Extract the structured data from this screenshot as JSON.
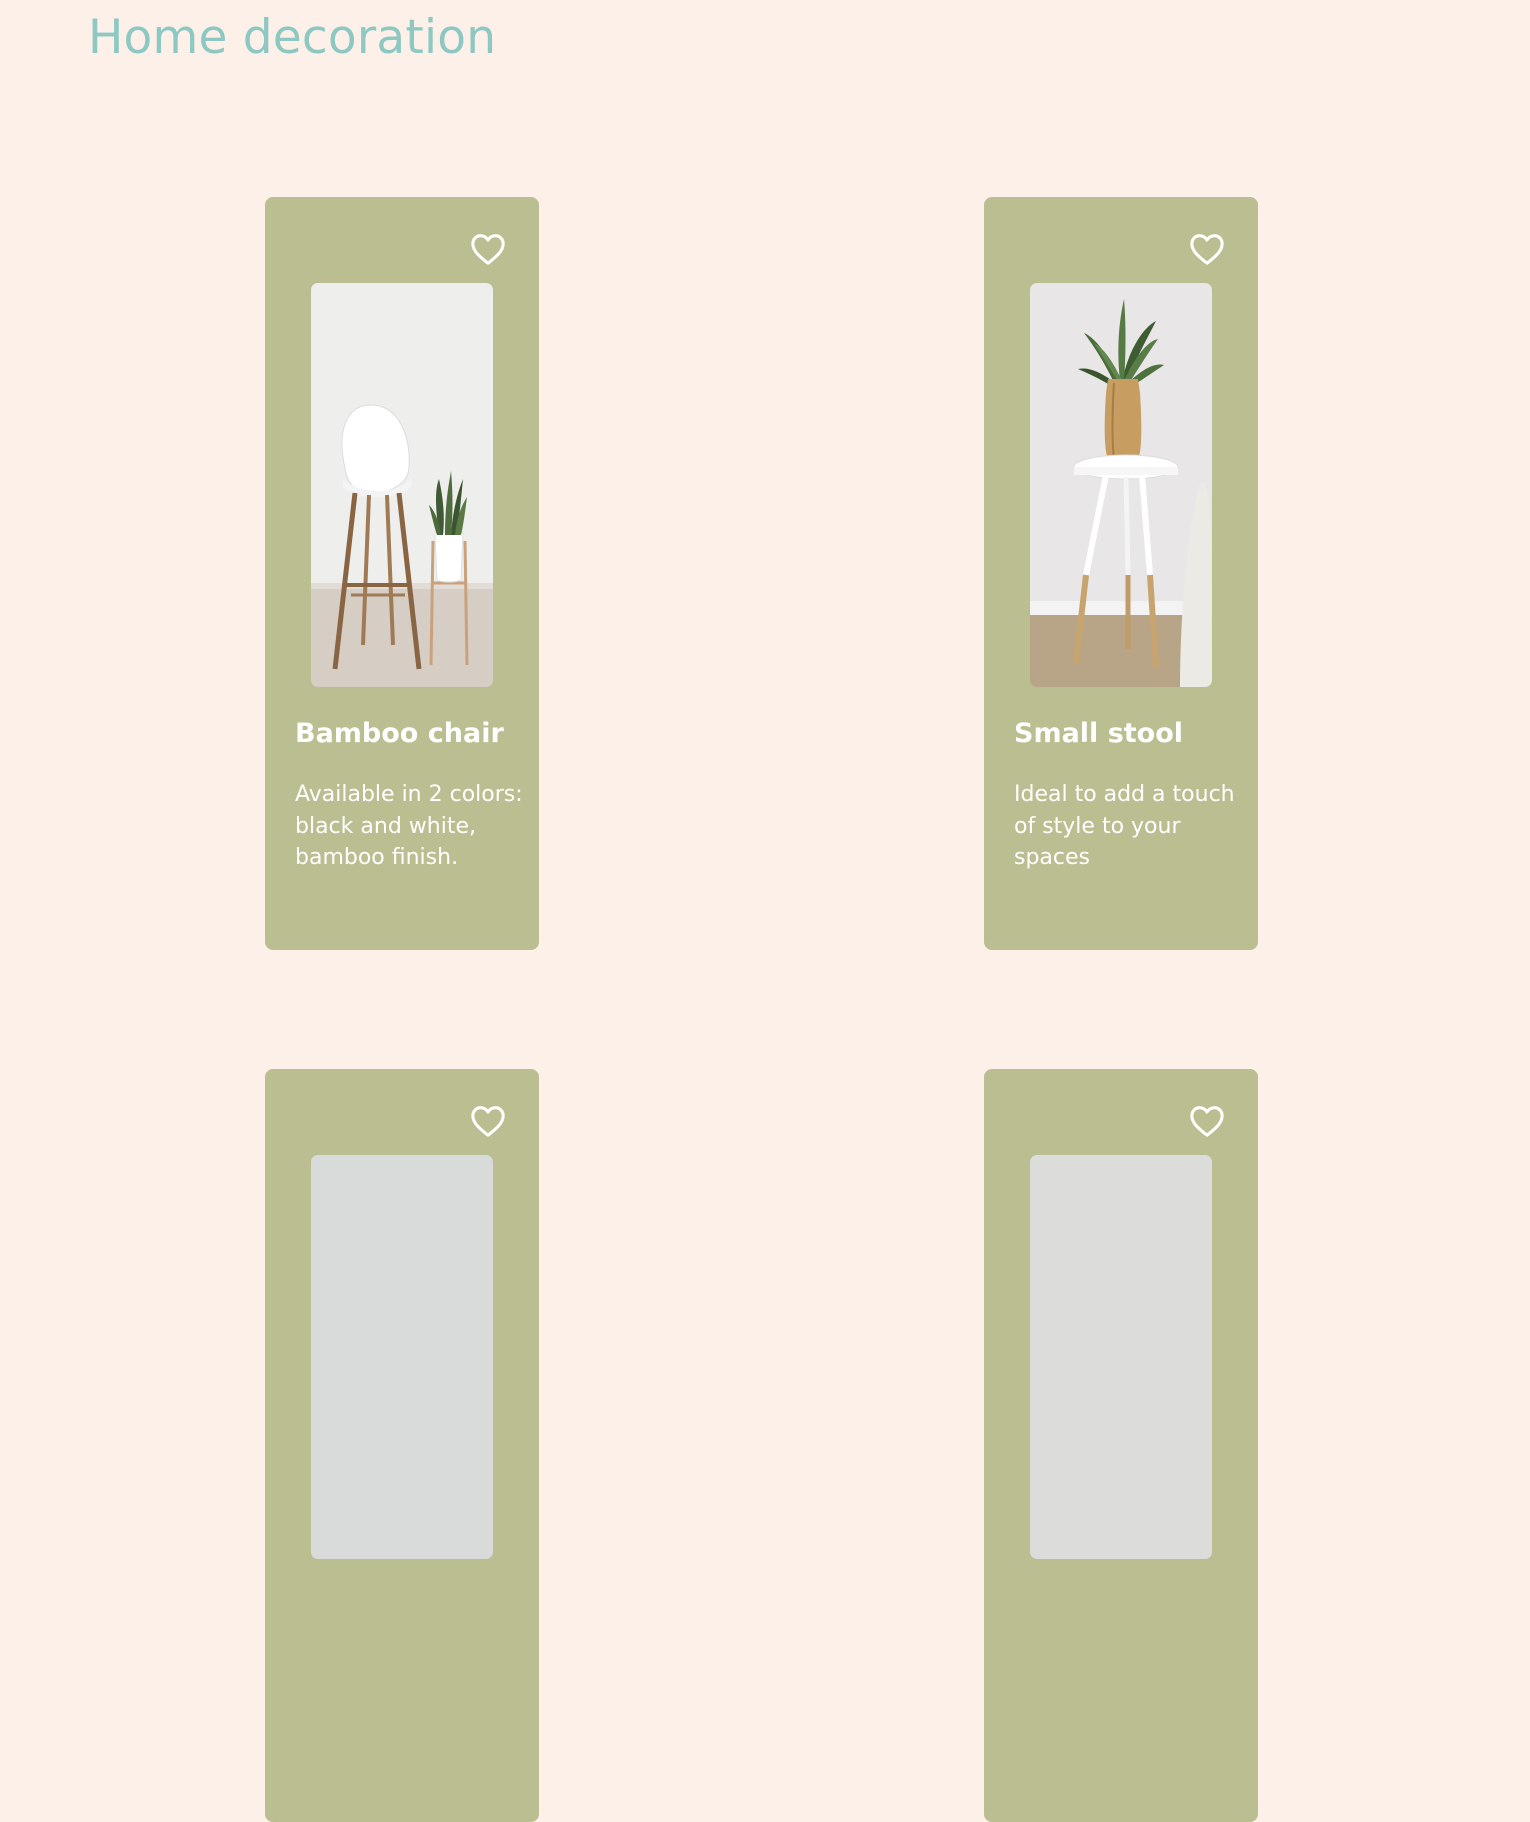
{
  "page": {
    "title": "Home decoration"
  },
  "colors": {
    "background": "#fcf0e9",
    "title": "#8dc8c2",
    "card": "#bbbe91",
    "text": "#ffffff"
  },
  "products": [
    {
      "name": "Bamboo chair",
      "description": "Available in 2 colors: black and white, bamboo finish.",
      "favorite_icon": "heart-outline-icon"
    },
    {
      "name": "Small stool",
      "description": "Ideal to add a touch of style to your spaces",
      "favorite_icon": "heart-outline-icon"
    },
    {
      "name": "",
      "description": "",
      "favorite_icon": "heart-outline-icon"
    },
    {
      "name": "",
      "description": "",
      "favorite_icon": "heart-outline-icon"
    }
  ]
}
